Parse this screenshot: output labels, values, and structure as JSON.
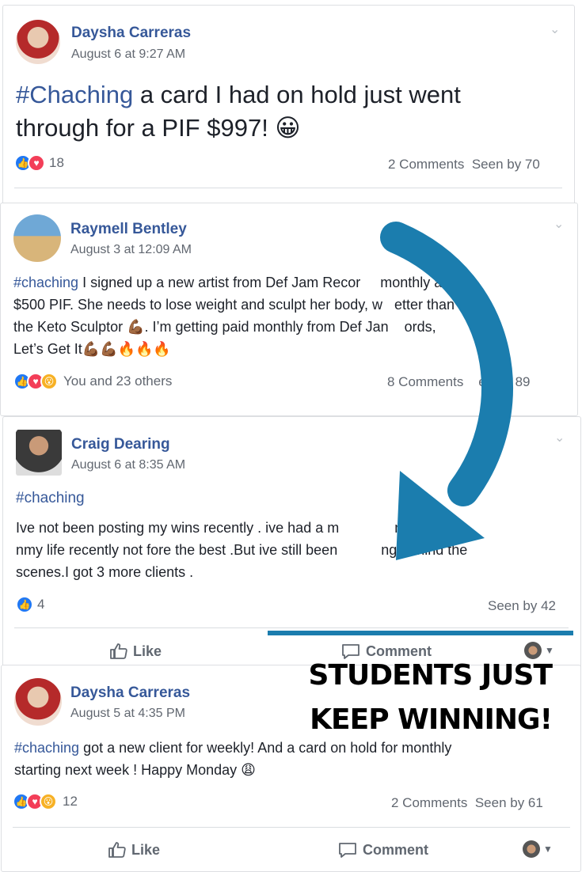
{
  "posts": [
    {
      "author": "Daysha Carreras",
      "time": "August 6 at 9:27 AM",
      "hashtag": "#Chaching",
      "text": " a card I had on hold just went",
      "text2": "through for a PIF $997! 😀",
      "reaction_count": "18",
      "comments": "2 Comments",
      "seen": "Seen by 70"
    },
    {
      "author": "Raymell Bentley",
      "time": "August 3 at 12:09 AM",
      "hashtag": "#chaching",
      "line1": " I signed up a new artist from Def Jam Recor     monthly at",
      "line2": "$500 PIF. She needs to lose weight and sculpt her body, w   etter than",
      "line3": "the Keto Sculptor 💪🏾. I’m getting paid monthly from Def Jan    ords,",
      "line4": "Let’s Get It💪🏾💪🏾🔥🔥🔥",
      "reactions_text": "You and 23 others",
      "comments": "8 Comments",
      "seen": "en by 89"
    },
    {
      "author": "Craig Dearing",
      "time": "August 6 at 8:35 AM",
      "hashtag": "#chaching",
      "line1": "Ive not been posting my wins recently . ive had a m              nal shift in",
      "line2": "nmy life recently not fore the best .But ive still been           ng behind the",
      "line3": "scenes.I got 3 more clients .",
      "reaction_count": "4",
      "seen": "Seen by 42",
      "like_label": "Like",
      "comment_label": "Comment"
    },
    {
      "author": "Daysha Carreras",
      "time": "August 5 at 4:35 PM",
      "hashtag": "#chaching",
      "line1": " got a new client for weekly! And a card on hold for monthly",
      "line2": "starting next week ! Happy Monday 😩",
      "reaction_count": "12",
      "comments": "2 Comments",
      "seen": "Seen by 61",
      "like_label": "Like",
      "comment_label": "Comment"
    }
  ],
  "banner": {
    "line1": "STUDENTS JUST",
    "line2": "KEEP WINNING!"
  },
  "colors": {
    "arrow": "#1b7dae",
    "link": "#365899"
  }
}
